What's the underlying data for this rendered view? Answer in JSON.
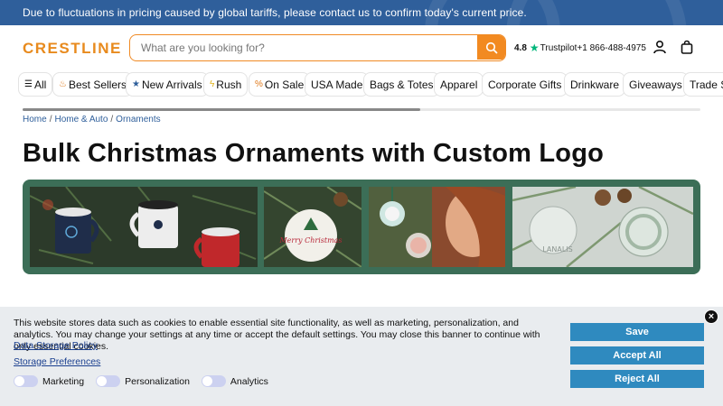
{
  "top_banner": {
    "message": "Due to fluctuations in pricing caused by global tariffs, please contact us to confirm today's current price."
  },
  "header": {
    "logo": "CRESTLINE",
    "search_placeholder": "What are you looking for?",
    "trustpilot_rating": "4.8",
    "trustpilot_label": "Trustpilot",
    "phone": "+1 866-488-4975",
    "accent_color": "#f28a21"
  },
  "nav": {
    "items": [
      {
        "label": "All",
        "icon": "menu-icon"
      },
      {
        "label": "Best Sellers",
        "icon": "flame-icon"
      },
      {
        "label": "New Arrivals",
        "icon": "star-icon"
      },
      {
        "label": "Rush",
        "icon": "lightning-icon"
      },
      {
        "label": "On Sale",
        "icon": "percent-icon"
      },
      {
        "label": "USA Made",
        "icon": ""
      },
      {
        "label": "Bags & Totes",
        "icon": ""
      },
      {
        "label": "Apparel",
        "icon": ""
      },
      {
        "label": "Corporate Gifts",
        "icon": ""
      },
      {
        "label": "Drinkware",
        "icon": ""
      },
      {
        "label": "Giveaways",
        "icon": ""
      },
      {
        "label": "Trade Sh",
        "icon": ""
      }
    ]
  },
  "breadcrumb": {
    "items": [
      "Home",
      "Home & Auto",
      "Ornaments"
    ]
  },
  "page": {
    "title": "Bulk Christmas Ornaments with Custom Logo"
  },
  "hero": {
    "ornament_text_1": "Merry Christmas",
    "ornament_text_2": "LANALIS",
    "background_color": "#3c6e57"
  },
  "cookie_banner": {
    "text": "This website stores data such as cookies to enable essential site functionality, as well as marketing, personalization, and analytics. You may change your settings at any time or accept the default settings. You may close this banner to continue with only essential cookies.",
    "data_storage_policy": "Data Storage Policy",
    "storage_preferences": "Storage Preferences",
    "toggles": [
      "Marketing",
      "Personalization",
      "Analytics"
    ],
    "save_label": "Save",
    "accept_label": "Accept All",
    "reject_label": "Reject All",
    "close_symbol": "×"
  }
}
